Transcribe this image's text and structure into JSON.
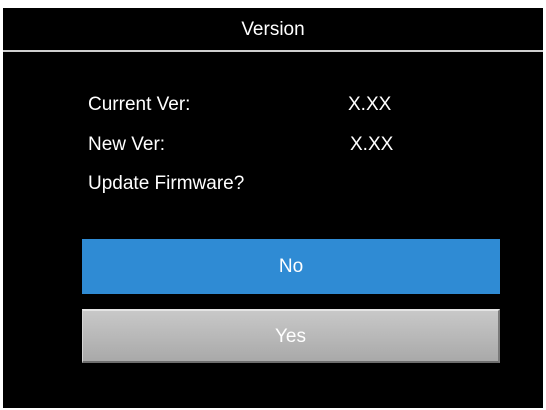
{
  "dialog": {
    "title": "Version",
    "rows": [
      {
        "label": "Current Ver:",
        "value": "X.XX"
      },
      {
        "label": "New Ver:",
        "value": "X.XX"
      }
    ],
    "question": "Update Firmware?",
    "buttons": {
      "no_label": "No",
      "yes_label": "Yes"
    }
  },
  "colors": {
    "background": "#000000",
    "text": "#ffffff",
    "selected_button": "#2f8bd4",
    "unselected_button": "#b8b8b8"
  }
}
